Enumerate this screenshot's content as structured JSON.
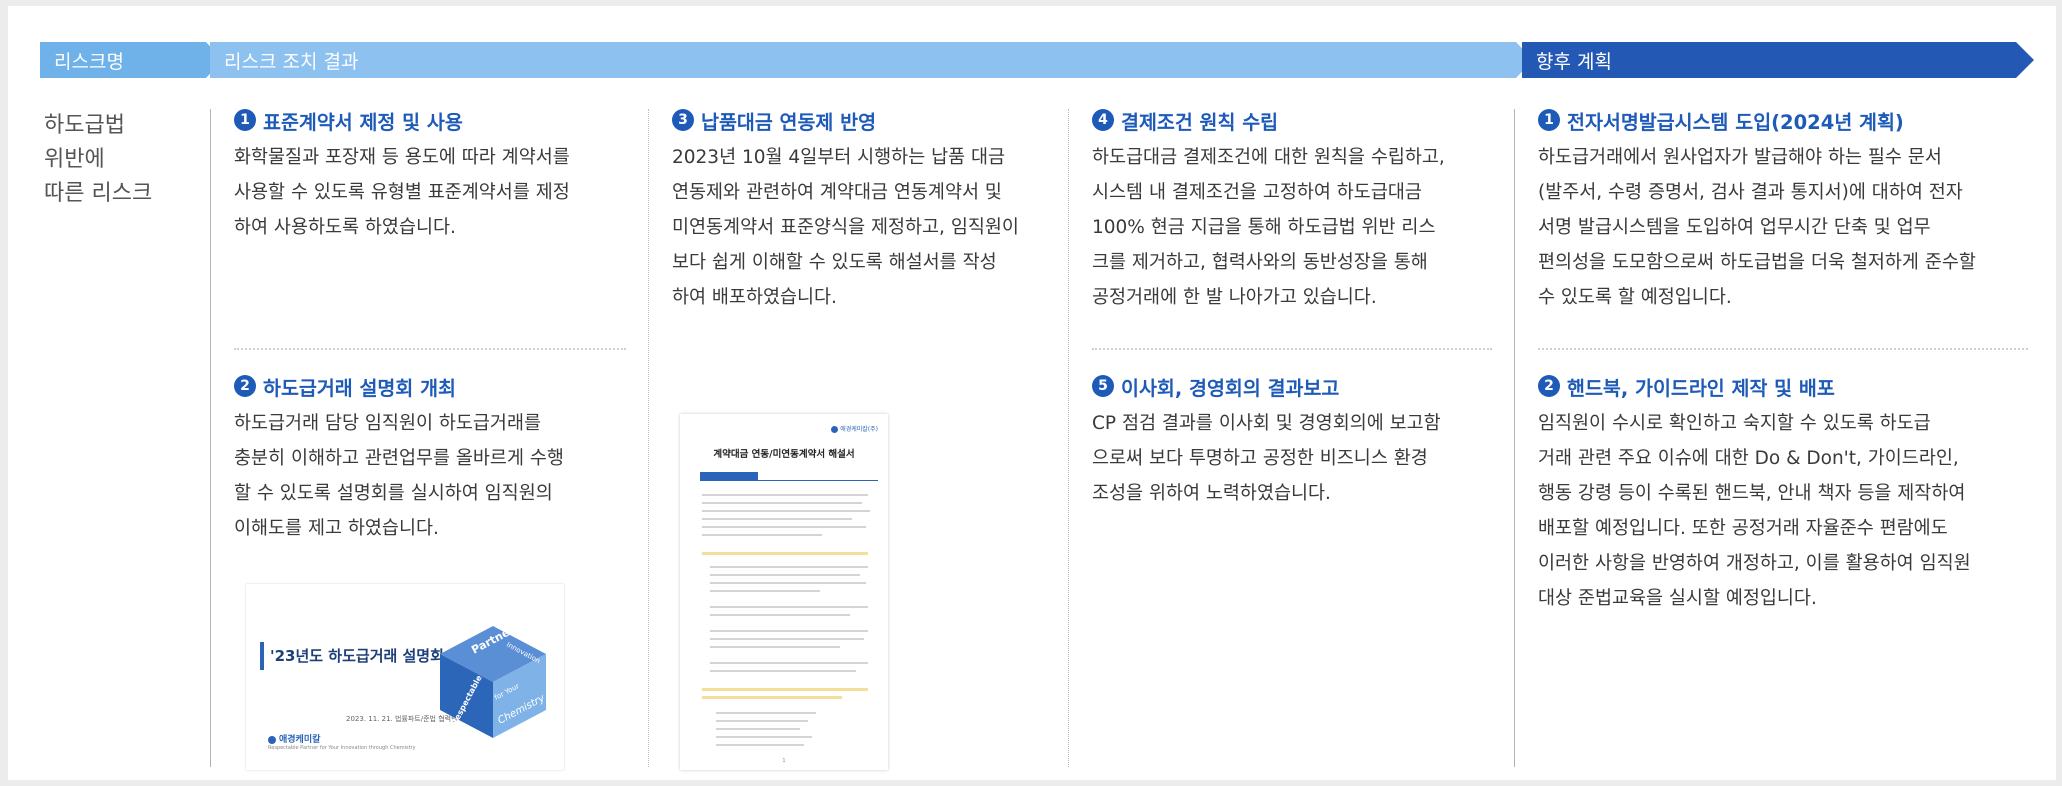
{
  "header": {
    "risk_label": "리스크명",
    "result_label": "리스크 조치 결과",
    "plan_label": "향후 계획"
  },
  "risk_name": [
    "하도급법",
    "위반에",
    "따른 리스크"
  ],
  "results": [
    {
      "num": "1",
      "title": "표준계약서 제정 및 사용",
      "body": [
        "화학물질과 포장재 등 용도에 따라 계약서를",
        "사용할 수 있도록 유형별 표준계약서를 제정",
        "하여 사용하도록 하였습니다."
      ]
    },
    {
      "num": "2",
      "title": "하도급거래 설명회 개최",
      "body": [
        "하도급거래 담당 임직원이 하도급거래를",
        "충분히 이해하고 관련업무를 올바르게 수행",
        "할 수 있도록 설명회를 실시하여 임직원의",
        "이해도를 제고 하였습니다."
      ]
    },
    {
      "num": "3",
      "title": "납품대금 연동제 반영",
      "body": [
        "2023년 10월 4일부터 시행하는 납품 대금",
        "연동제와 관련하여 계약대금 연동계약서 및",
        "미연동계약서 표준양식을 제정하고, 임직원이",
        "보다 쉽게 이해할 수 있도록 해설서를 작성",
        "하여 배포하였습니다."
      ]
    },
    {
      "num": "4",
      "title": "결제조건 원칙 수립",
      "body": [
        "하도급대금 결제조건에 대한 원칙을 수립하고,",
        "시스템 내 결제조건을 고정하여 하도급대금",
        "100% 현금 지급을 통해 하도급법 위반 리스",
        "크를 제거하고, 협력사와의 동반성장을 통해",
        "공정거래에 한 발 나아가고 있습니다."
      ]
    },
    {
      "num": "5",
      "title": "이사회, 경영회의 결과보고",
      "body": [
        "CP 점검 결과를 이사회 및 경영회의에 보고함",
        "으로써 보다 투명하고 공정한 비즈니스 환경",
        "조성을 위하여 노력하였습니다."
      ]
    }
  ],
  "plans": [
    {
      "num": "1",
      "title": "전자서명발급시스템 도입(2024년 계획)",
      "body": [
        "하도급거래에서 원사업자가 발급해야 하는 필수 문서",
        "(발주서, 수령 증명서, 검사 결과 통지서)에 대하여 전자",
        "서명 발급시스템을 도입하여 업무시간 단축 및 업무",
        "편의성을 도모함으로써 하도급법을 더욱 철저하게 준수할",
        "수 있도록 할 예정입니다."
      ]
    },
    {
      "num": "2",
      "title": "핸드북, 가이드라인 제작 및 배포",
      "body": [
        "임직원이 수시로 확인하고 숙지할 수 있도록 하도급",
        "거래 관련 주요 이슈에 대한 Do & Don't, 가이드라인,",
        "행동 강령 등이 수록된 핸드북, 안내 책자 등을 제작하여",
        "배포할 예정입니다. 또한 공정거래 자율준수 편람에도",
        "이러한 사항을 반영하여 개정하고, 이를 활용하여 임직원",
        "대상 준법교육을 실시할 예정입니다."
      ]
    }
  ],
  "slide_thumb": {
    "title": "'23년도 하도급거래 설명회",
    "date": "2023. 11. 21. 법률파트/준법 협력팀",
    "logo": "애경케미칼",
    "logo_sub": "Respectable Partner for Your Innovation through Chemistry",
    "cube_words": [
      "Partner",
      "Innovation",
      "Respectable",
      "for Your",
      "Chemistry"
    ]
  },
  "doc_thumb": {
    "logo": "애경케미칼(주)",
    "title": "계약대금 연동/미연동계약서 해설서",
    "page": "1"
  },
  "colors": {
    "header_risk": "#6fb2ea",
    "header_result": "#8cc1f0",
    "header_plan": "#2359b5",
    "accent": "#1e5bb8"
  }
}
